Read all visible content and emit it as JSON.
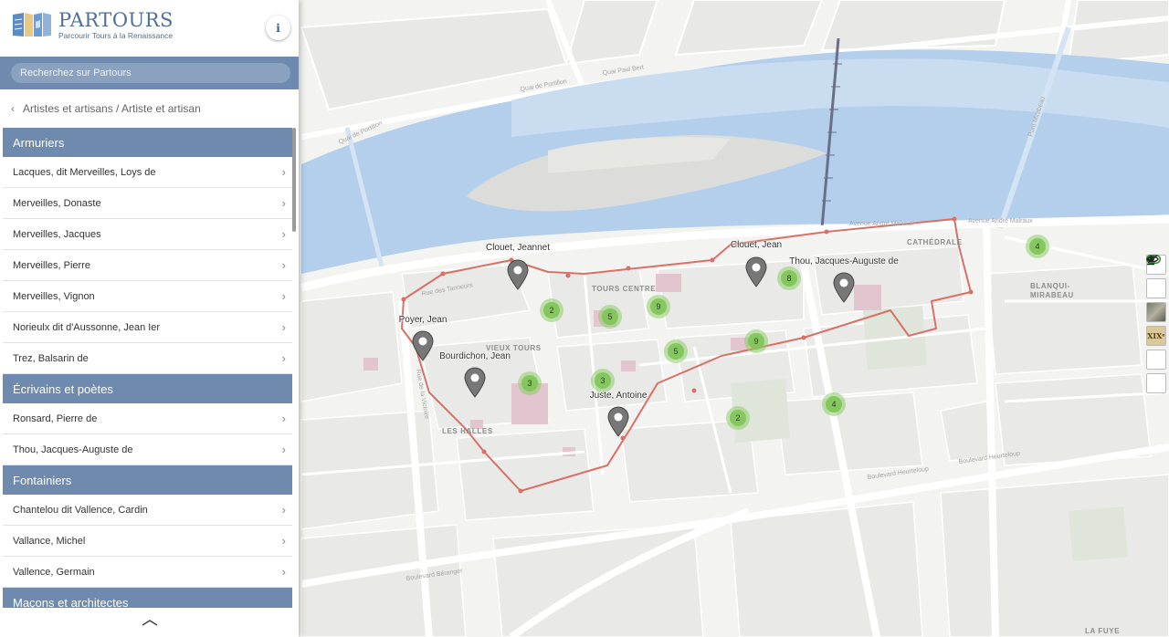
{
  "brand": {
    "name": "PARTOURS",
    "tagline": "Parcourir Tours à la Renaissance",
    "info_label": "i"
  },
  "search": {
    "placeholder": "Recherchez sur Partours"
  },
  "breadcrumb": {
    "text": "Artistes et artisans / Artiste et artisan"
  },
  "sections": [
    {
      "title": "Armuriers",
      "items": [
        "Lacques, dit Merveilles, Loys de",
        "Merveilles, Donaste",
        "Merveilles, Jacques",
        "Merveilles, Pierre",
        "Merveilles, Vignon",
        "Norieulx dit d'Aussonne, Jean Ier",
        "Trez, Balsarin de"
      ]
    },
    {
      "title": "Écrivains et poètes",
      "items": [
        "Ronsard, Pierre de",
        "Thou, Jacques-Auguste de"
      ]
    },
    {
      "title": "Fontainiers",
      "items": [
        "Chantelou dit Vallence, Cardin",
        "Vallance, Michel",
        "Vallence, Germain"
      ]
    },
    {
      "title": "Maçons et architectes",
      "items": []
    }
  ],
  "map": {
    "place_labels": [
      "TOURS CENTRE",
      "VIEUX TOURS",
      "LES HALLES",
      "CATHÉDRALE",
      "BLANQUI-",
      "MIRABEAU",
      "LA FUYE"
    ],
    "street_labels": [
      "Quai de Portillon",
      "Quai Paul Bert",
      "Avenue André Malraux",
      "Avenue André Malraux",
      "Rue des Tanneurs",
      "Boulevard Béranger",
      "Boulevard Heurteloup",
      "Boulevard Heurteloup",
      "Rue de la Victoire",
      "Pont Mirabeau",
      "Quai de Portillon"
    ],
    "clusters": [
      {
        "count": "2"
      },
      {
        "count": "5"
      },
      {
        "count": "9"
      },
      {
        "count": "5"
      },
      {
        "count": "9"
      },
      {
        "count": "8"
      },
      {
        "count": "3"
      },
      {
        "count": "3"
      },
      {
        "count": "2"
      },
      {
        "count": "4"
      },
      {
        "count": "4"
      }
    ],
    "pins": [
      {
        "label": "Clouet, Jeannet"
      },
      {
        "label": "Clouet, Jean"
      },
      {
        "label": "Thou, Jacques-Auguste de"
      },
      {
        "label": "Poyer, Jean"
      },
      {
        "label": "Bourdichon, Jean"
      },
      {
        "label": "Juste, Antoine"
      }
    ],
    "controls": {
      "locate": "locate-icon",
      "toggle": "toggle-icon",
      "photo": "satellite-layer-icon",
      "xix": "XIXᵉ",
      "eye": "eye-off-icon",
      "download": "download-icon"
    }
  },
  "colors": {
    "accent": "#6e8aae",
    "river": "#a9c8e8",
    "river_shallow": "#c7dcef",
    "route": "#d97066",
    "cluster": "#8dce68"
  }
}
